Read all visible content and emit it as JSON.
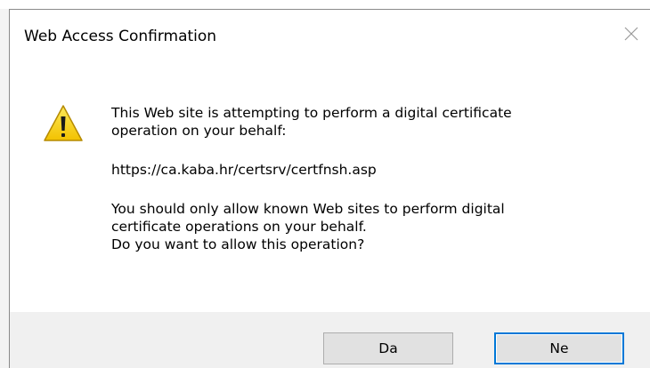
{
  "window": {
    "title": "Web Access Confirmation",
    "close_icon": "close-icon"
  },
  "message": {
    "icon": "warning-icon",
    "line1": "This Web site is attempting to perform a digital certificate",
    "line2": "operation on your behalf:",
    "url": "https://ca.kaba.hr/certsrv/certfnsh.asp",
    "line3": "You should only allow known Web sites to perform digital",
    "line4": "certificate operations on your behalf.",
    "line5": "Do you want to allow this operation?"
  },
  "buttons": {
    "yes_label": "Da",
    "no_label": "Ne"
  },
  "colors": {
    "focus_border": "#0078d7",
    "footer_bg": "#f0f0f0",
    "button_bg": "#e1e1e1",
    "warning_yellow": "#f7d21a"
  }
}
